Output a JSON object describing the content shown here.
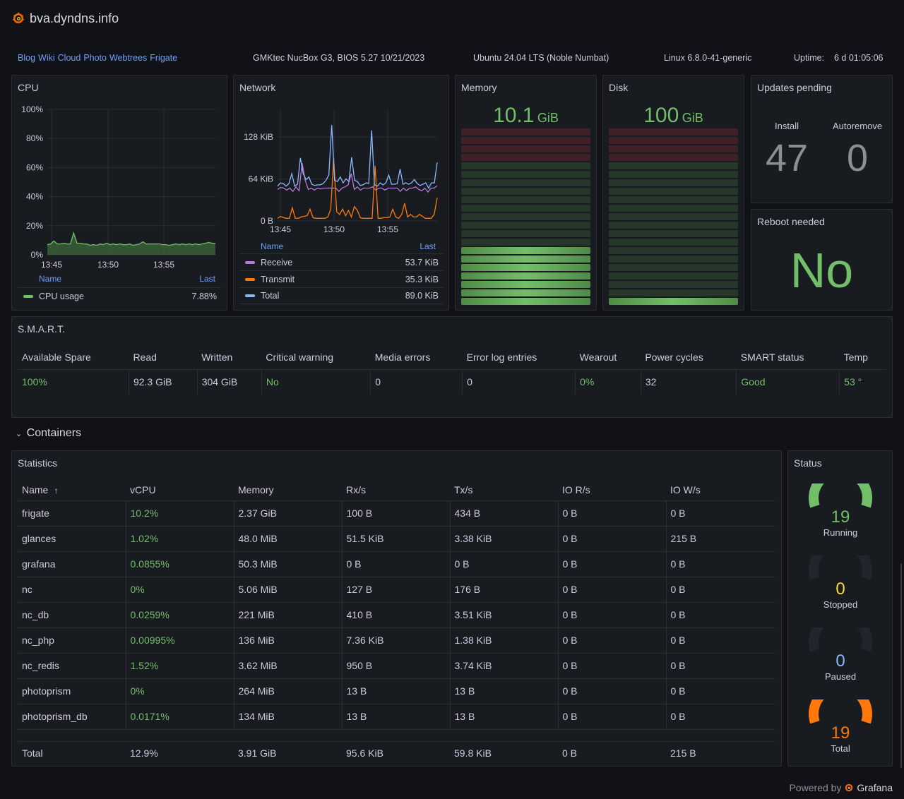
{
  "header": {
    "title": "bva.dyndns.info",
    "logo_icon": "grafana-logo-icon"
  },
  "infobar": {
    "links": [
      "Blog",
      "Wiki",
      "Cloud",
      "Photo",
      "Webtrees",
      "Frigate"
    ],
    "hardware": "GMKtec NucBox G3, BIOS 5.27 10/21/2023",
    "os": "Ubuntu 24.04 LTS (Noble Numbat)",
    "kernel": "Linux 6.8.0-41-generic",
    "uptime_label": "Uptime:",
    "uptime_value": "6 d 01:05:06"
  },
  "cpu": {
    "title": "CPU",
    "legend_name": "Name",
    "legend_last": "Last",
    "series_name": "CPU usage",
    "series_last": "7.88%",
    "color": "#73bf69"
  },
  "network": {
    "title": "Network",
    "legend_name": "Name",
    "legend_last": "Last",
    "series": [
      {
        "name": "Receive",
        "last": "53.7 KiB",
        "color": "#b877d9"
      },
      {
        "name": "Transmit",
        "last": "35.3 KiB",
        "color": "#ff780a"
      },
      {
        "name": "Total",
        "last": "89.0 KiB",
        "color": "#8ab8ff"
      }
    ]
  },
  "memory": {
    "title": "Memory",
    "value": "10.1",
    "unit": "GiB",
    "fill_fraction": 0.33
  },
  "disk": {
    "title": "Disk",
    "value": "100",
    "unit": "GiB",
    "fill_fraction": 0.05
  },
  "updates": {
    "title": "Updates pending",
    "install_label": "Install",
    "install_value": "47",
    "autoremove_label": "Autoremove",
    "autoremove_value": "0"
  },
  "reboot": {
    "title": "Reboot needed",
    "value": "No"
  },
  "smart": {
    "title": "S.M.A.R.T.",
    "columns": [
      "Available Spare",
      "Read",
      "Written",
      "Critical warning",
      "Media errors",
      "Error log entries",
      "Wearout",
      "Power cycles",
      "SMART status",
      "Temp"
    ],
    "values": [
      "100%",
      "92.3 GiB",
      "304 GiB",
      "No",
      "0",
      "0",
      "0%",
      "32",
      "Good",
      "53 °"
    ],
    "green": [
      true,
      false,
      false,
      true,
      false,
      false,
      true,
      false,
      true,
      true
    ]
  },
  "containers_section": {
    "title": "Containers",
    "chevron_icon": "chevron-down-icon"
  },
  "statistics": {
    "title": "Statistics",
    "columns": [
      "Name",
      "vCPU",
      "Memory",
      "Rx/s",
      "Tx/s",
      "IO R/s",
      "IO W/s"
    ],
    "sort_icon": "↑",
    "rows": [
      [
        "frigate",
        "10.2%",
        "2.37 GiB",
        "100 B",
        "434 B",
        "0 B",
        "0 B"
      ],
      [
        "glances",
        "1.02%",
        "48.0 MiB",
        "51.5 KiB",
        "3.38 KiB",
        "0 B",
        "215 B"
      ],
      [
        "grafana",
        "0.0855%",
        "50.3 MiB",
        "0 B",
        "0 B",
        "0 B",
        "0 B"
      ],
      [
        "nc",
        "0%",
        "5.06 MiB",
        "127 B",
        "176 B",
        "0 B",
        "0 B"
      ],
      [
        "nc_db",
        "0.0259%",
        "221 MiB",
        "410 B",
        "3.51 KiB",
        "0 B",
        "0 B"
      ],
      [
        "nc_php",
        "0.00995%",
        "136 MiB",
        "7.36 KiB",
        "1.38 KiB",
        "0 B",
        "0 B"
      ],
      [
        "nc_redis",
        "1.52%",
        "3.62 MiB",
        "950 B",
        "3.74 KiB",
        "0 B",
        "0 B"
      ],
      [
        "photoprism",
        "0%",
        "264 MiB",
        "13 B",
        "13 B",
        "0 B",
        "0 B"
      ],
      [
        "photoprism_db",
        "0.0171%",
        "134 MiB",
        "13 B",
        "13 B",
        "0 B",
        "0 B"
      ]
    ],
    "total": [
      "Total",
      "12.9%",
      "3.91 GiB",
      "95.6 KiB",
      "59.8 KiB",
      "0 B",
      "215 B"
    ]
  },
  "status": {
    "title": "Status",
    "gauges": [
      {
        "label": "Running",
        "value": "19",
        "fraction": 1.0,
        "color": "#73bf69"
      },
      {
        "label": "Stopped",
        "value": "0",
        "fraction": 0.0,
        "color": "#fade2a"
      },
      {
        "label": "Paused",
        "value": "0",
        "fraction": 0.0,
        "color": "#8ab8ff"
      },
      {
        "label": "Total",
        "value": "19",
        "fraction": 1.0,
        "color": "#ff780a"
      }
    ]
  },
  "footer": {
    "powered_by": "Powered by",
    "brand": "Grafana"
  },
  "chart_data": [
    {
      "type": "area",
      "title": "CPU",
      "x": [
        "13:44",
        "13:45",
        "13:46",
        "13:47",
        "13:48",
        "13:49",
        "13:50",
        "13:51",
        "13:52",
        "13:53",
        "13:54",
        "13:55",
        "13:56",
        "13:57",
        "13:58",
        "13:59"
      ],
      "xticks": [
        "13:45",
        "13:50",
        "13:55"
      ],
      "yticks": [
        "0%",
        "20%",
        "40%",
        "60%",
        "80%",
        "100%"
      ],
      "ylim": [
        0,
        100
      ],
      "series": [
        {
          "name": "CPU usage",
          "values": [
            7,
            7.5,
            9.5,
            7.5,
            7.5,
            8,
            7.5,
            7.5,
            15,
            8,
            8,
            7.5,
            7.5,
            6.5,
            7,
            6.5,
            7.5,
            7,
            8,
            7,
            7.5,
            7,
            7.5,
            7,
            7,
            7.5,
            6.5,
            7,
            7.5,
            9,
            7.5,
            7.5,
            7.5,
            7.5,
            7.5,
            7,
            7,
            6.5,
            7,
            7.5,
            7,
            7.5,
            7,
            7.5,
            7,
            7.5,
            7,
            7.5,
            8,
            8.5,
            8,
            7.88
          ]
        }
      ],
      "legend": "bottom"
    },
    {
      "type": "line",
      "title": "Network",
      "xticks": [
        "13:45",
        "13:50",
        "13:55"
      ],
      "yticks": [
        "0 B",
        "64 KiB",
        "128 KiB"
      ],
      "ylim": [
        0,
        170
      ],
      "series": [
        {
          "name": "Receive",
          "values": [
            48,
            51,
            50,
            47,
            50,
            45,
            52,
            46,
            88,
            62,
            48,
            50,
            47,
            50,
            49,
            50,
            50,
            50,
            50,
            50,
            45,
            50,
            52,
            55,
            72,
            48,
            52,
            47,
            50,
            50,
            50,
            52,
            47,
            50,
            50,
            47,
            50,
            50,
            50,
            50,
            45,
            50,
            46,
            50,
            50,
            52,
            48,
            46,
            50,
            44,
            50,
            50,
            53.7
          ]
        },
        {
          "name": "Transmit",
          "values": [
            4,
            7,
            5,
            4,
            4,
            20,
            4,
            4,
            6,
            7,
            8,
            18,
            5,
            4,
            4,
            4,
            4,
            6,
            18,
            95,
            14,
            10,
            18,
            8,
            16,
            6,
            22,
            16,
            5,
            4,
            4,
            4,
            4,
            84,
            4,
            4,
            5,
            5,
            6,
            18,
            6,
            4,
            10,
            27,
            6,
            10,
            6,
            6,
            10,
            7,
            4,
            4,
            4,
            10,
            35.3
          ]
        },
        {
          "name": "Total",
          "values": [
            53,
            58,
            57,
            53,
            57,
            72,
            53,
            56,
            96,
            72,
            63,
            67,
            56,
            54,
            55,
            55,
            57,
            62,
            70,
            146,
            62,
            60,
            67,
            58,
            64,
            60,
            97,
            62,
            60,
            54,
            55,
            58,
            57,
            138,
            55,
            53,
            58,
            55,
            58,
            70,
            56,
            56,
            57,
            79,
            56,
            58,
            56,
            58,
            63,
            57,
            54,
            56,
            58,
            50,
            58,
            58,
            89
          ]
        }
      ],
      "legend": "bottom"
    }
  ]
}
